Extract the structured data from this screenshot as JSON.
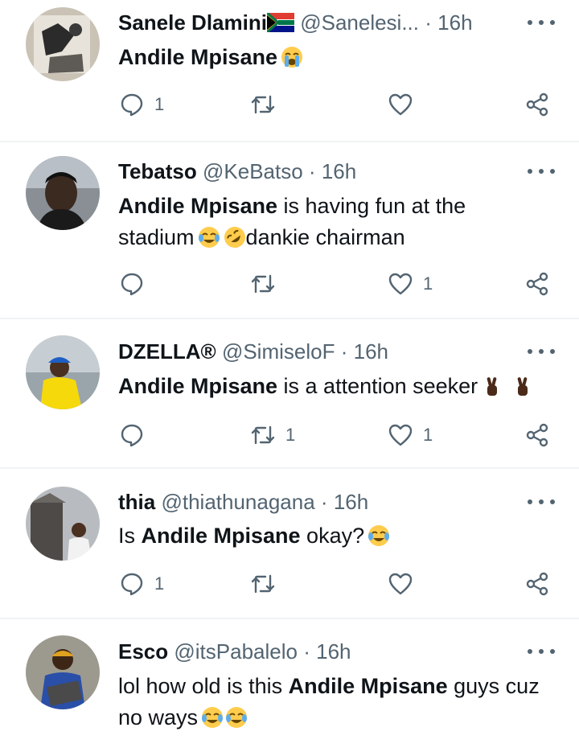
{
  "colors": {
    "text": "#0f1419",
    "muted": "#536471",
    "divider": "#eff3f4"
  },
  "tweets": [
    {
      "name": "Sanele Dlamini",
      "handle": "@Sanelesi...",
      "dot": "·",
      "time": "16h",
      "text_bold": "Andile Mpisane",
      "text_rest": "",
      "emojis": [
        "loudly-crying-face-emoji"
      ],
      "reply_count": "1",
      "retweet_count": "",
      "like_count": "",
      "flag": "south-africa-flag-icon"
    },
    {
      "name": "Tebatso",
      "handle": "@KeBatso",
      "dot": "·",
      "time": "16h",
      "text_bold": "Andile Mpisane",
      "text_rest": " is having fun at the stadium",
      "text_tail": "dankie chairman",
      "emojis": [
        "tears-of-joy-emoji",
        "rolling-on-floor-laughing-emoji"
      ],
      "reply_count": "",
      "retweet_count": "",
      "like_count": "1"
    },
    {
      "name": "DZELLA®",
      "handle": "@SimiseloF",
      "dot": "·",
      "time": "16h",
      "text_bold": "Andile Mpisane",
      "text_rest": " is a attention seeker",
      "emojis": [
        "crossed-fingers-emoji",
        "crossed-fingers-emoji"
      ],
      "reply_count": "",
      "retweet_count": "1",
      "like_count": "1"
    },
    {
      "name": "thia",
      "handle": "@thiathunagana",
      "dot": "·",
      "time": "16h",
      "text_pre": "Is ",
      "text_bold": "Andile Mpisane",
      "text_rest": " okay?",
      "emojis": [
        "tears-of-joy-emoji"
      ],
      "reply_count": "1",
      "retweet_count": "",
      "like_count": ""
    },
    {
      "name": "Esco",
      "handle": "@itsPabalelo",
      "dot": "·",
      "time": "16h",
      "text_pre": "lol how old is this ",
      "text_bold": "Andile Mpisane",
      "text_rest": " guys cuz no ways",
      "emojis": [
        "tears-of-joy-emoji",
        "tears-of-joy-emoji"
      ],
      "reply_count": "",
      "retweet_count": "",
      "like_count": ""
    }
  ]
}
